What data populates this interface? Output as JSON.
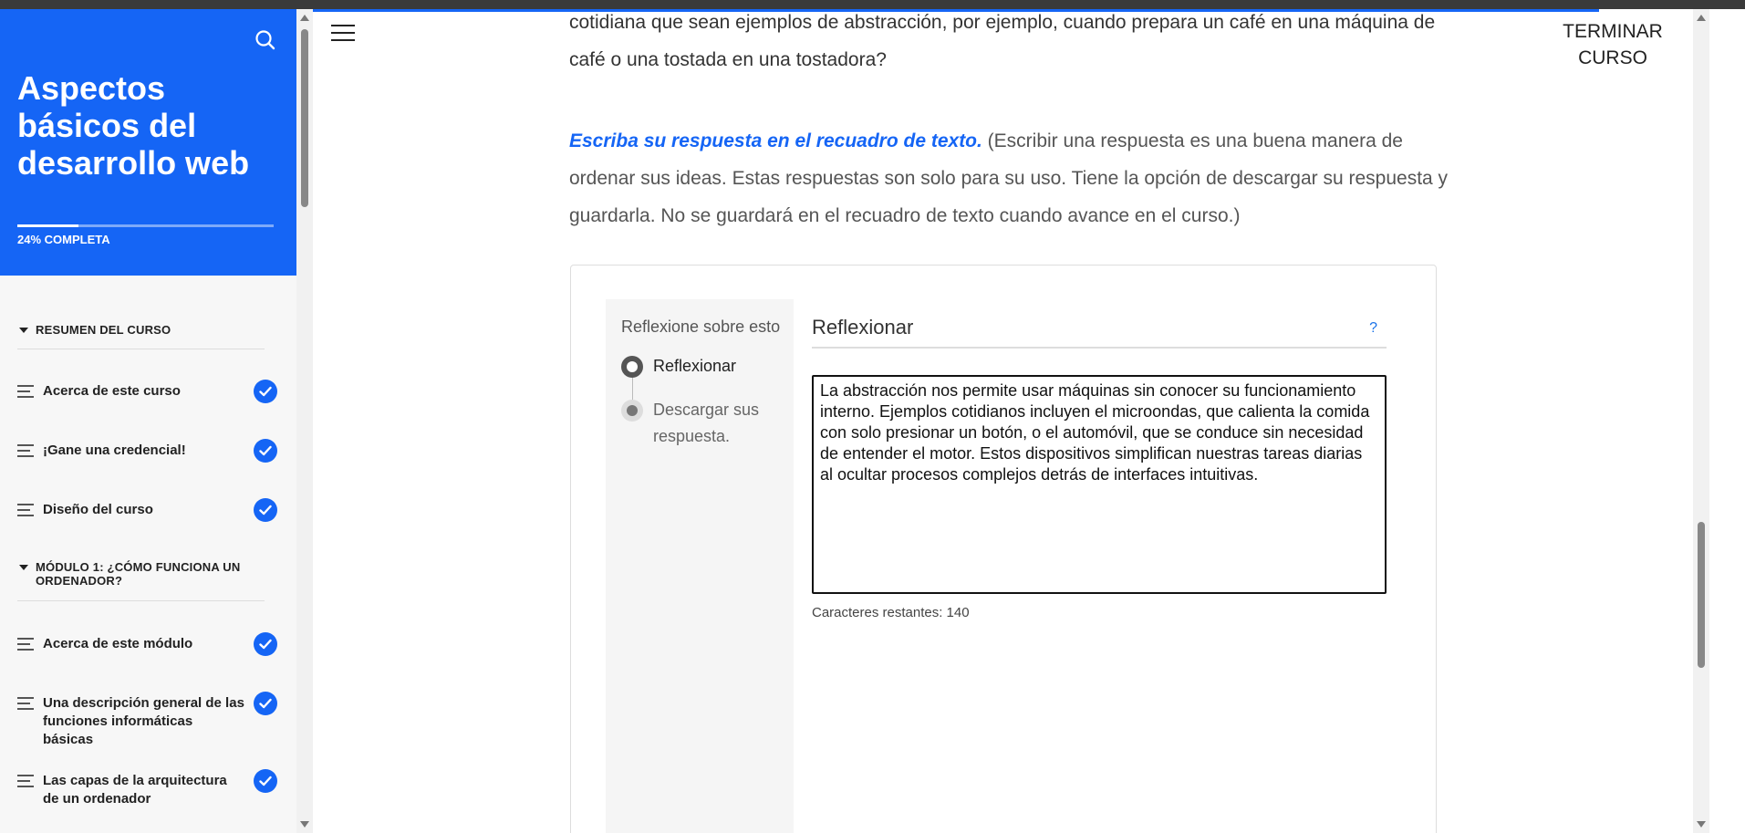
{
  "sidebar": {
    "course_title": "Aspectos básicos del desarrollo web",
    "progress_label": "24% COMPLETA",
    "progress_percent": 24,
    "sections": [
      {
        "title": "RESUMEN DEL CURSO"
      },
      {
        "title": "MÓDULO 1: ¿CÓMO FUNCIONA UN ORDENADOR?"
      }
    ],
    "items": [
      {
        "label": "Acerca de este curso",
        "completed": true
      },
      {
        "label": "¡Gane una credencial!",
        "completed": true
      },
      {
        "label": "Diseño del curso",
        "completed": true
      },
      {
        "label": "Acerca de este módulo",
        "completed": true
      },
      {
        "label": "Una descripción general de las funciones informáticas básicas",
        "completed": true
      },
      {
        "label": "Las capas de la arquitectura de un ordenador",
        "completed": true
      }
    ]
  },
  "header": {
    "finish_button": "TERMINAR CURSO"
  },
  "content": {
    "para1": "cotidiana que sean ejemplos de abstracción, por ejemplo, cuando prepara un café en una máquina de café o una tostada en una tostadora?",
    "para2_emphasis": "Escriba su respuesta en el recuadro de texto.",
    "para2_rest": " (Escribir una respuesta es una buena manera de ordenar sus ideas. Estas respuestas son solo para su uso. Tiene la opción de descargar su respuesta y guardarla. No se guardará en el recuadro de texto cuando avance en el curso.)"
  },
  "activity": {
    "steps_title": "Reflexione sobre esto",
    "steps": [
      {
        "label": "Reflexionar",
        "state": "current"
      },
      {
        "label": "Descargar sus respuesta.",
        "state": "pending"
      }
    ],
    "heading": "Reflexionar",
    "help": "?",
    "answer": "La abstracción nos permite usar máquinas sin conocer su funcionamiento interno. Ejemplos cotidianos incluyen el microondas, que calienta la comida con solo presionar un botón, o el automóvil, que se conduce sin necesidad de entender el motor. Estos dispositivos simplifican nuestras tareas diarias al ocultar procesos complejos detrás de interfaces intuitivas.",
    "chars_remaining": "Caracteres restantes: 140"
  },
  "colors": {
    "brand_blue": "#1565f5",
    "help_blue": "#1a73e8"
  },
  "icons": {
    "search": "search-icon",
    "menu": "hamburger-menu-icon",
    "check": "checkmark-icon",
    "lesson": "lesson-lines-icon"
  }
}
